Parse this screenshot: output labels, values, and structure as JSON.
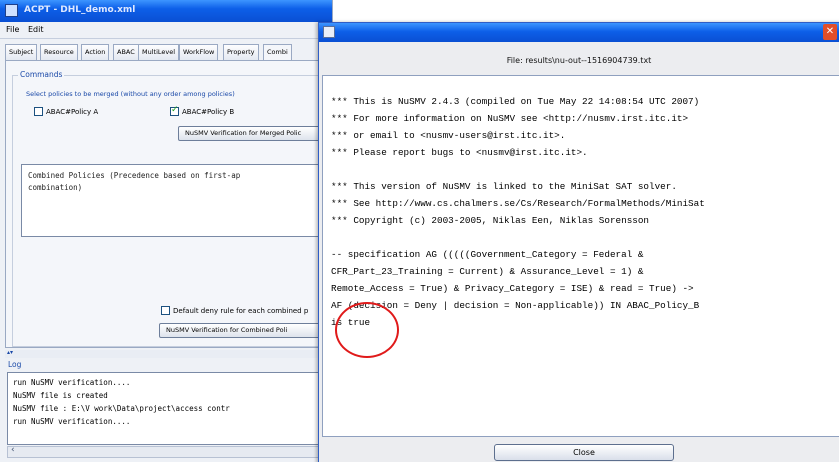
{
  "main_window": {
    "title": "ACPT - DHL_demo.xml",
    "menu": [
      "File",
      "Edit"
    ],
    "tabs": [
      "Subject",
      "Resource",
      "Action",
      "ABAC",
      "MultiLevel",
      "WorkFlow",
      "Property",
      "Combi"
    ],
    "commands": {
      "legend": "Commands",
      "hint": "Select policies to be merged (without any order among policies)",
      "policy_a": {
        "label": "ABAC#Policy A",
        "checked": false
      },
      "policy_b": {
        "label": "ABAC#Policy B",
        "checked": true
      },
      "merged_button": "NuSMV Verification for Merged Polic",
      "combined_text": [
        "Combined Policies (Precedence based on first-ap",
        "combination)"
      ],
      "deny_rule": {
        "label": "Default deny rule for each combined p",
        "checked": false
      },
      "combined_button": "NuSMV Verification for Combined Poli"
    },
    "log": {
      "label": "Log",
      "lines": [
        "run NuSMV verification....",
        "NuSMV file is created",
        "NuSMV file : E:\\V work\\Data\\project\\access contr",
        "run NuSMV verification...."
      ]
    }
  },
  "dialog": {
    "file_label": "File: results\\nu-out--1516904739.txt",
    "lines": [
      "*** This is NuSMV 2.4.3 (compiled on Tue May 22 14:08:54 UTC 2007)",
      "*** For more information on NuSMV see <http://nusmv.irst.itc.it>",
      "*** or email to <nusmv-users@irst.itc.it>.",
      "*** Please report bugs to <nusmv@irst.itc.it>.",
      "",
      "*** This version of NuSMV is linked to the MiniSat SAT solver.",
      "*** See http://www.cs.chalmers.se/Cs/Research/FormalMethods/MiniSat",
      "*** Copyright (c) 2003-2005, Niklas Een, Niklas Sorensson",
      "",
      "-- specification AG (((((Government_Category = Federal &",
      "CFR_Part_23_Training = Current) & Assurance_Level = 1) &",
      "Remote_Access = True) & Privacy_Category = ISE) & read = True) ->",
      "AF (decision = Deny | decision = Non-applicable)) IN ABAC_Policy_B",
      "is true"
    ],
    "close_label": "Close"
  },
  "colors": {
    "title_bar": "#0d5fe8",
    "accent_text": "#1a49a8",
    "highlight_circle": "#e01a1a"
  }
}
